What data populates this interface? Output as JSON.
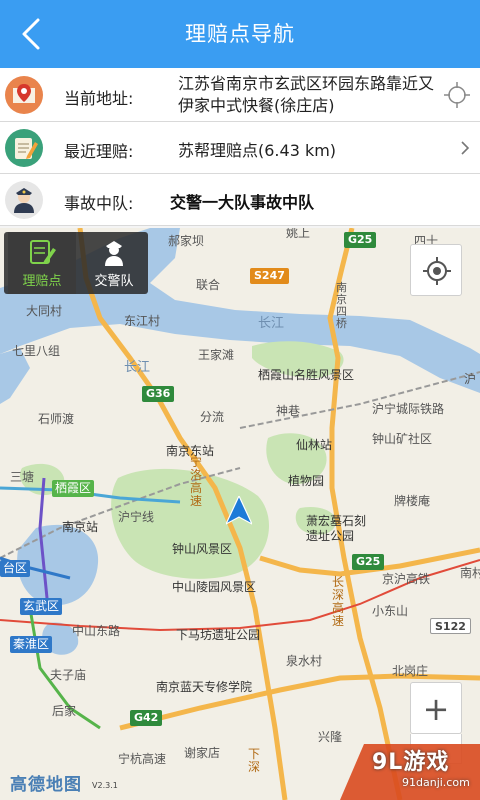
{
  "header": {
    "title": "理赔点导航"
  },
  "info": {
    "current_address": {
      "label": "当前地址:",
      "value": "江苏省南京市玄武区环园东路靠近又伊家中式快餐(徐庄店)"
    },
    "nearest_claim": {
      "label": "最近理赔:",
      "value": "苏帮理赔点(6.43 km)"
    },
    "accident_team": {
      "label": "事故中队:",
      "value": "交警一大队事故中队"
    }
  },
  "map": {
    "tabs": [
      {
        "label": "理赔点",
        "active": true
      },
      {
        "label": "交警队",
        "active": false
      }
    ],
    "logo": "高德地图",
    "version": "V2.3.1",
    "zoom_in_symbol": "+",
    "labels": {
      "jiabagang": "郝家坝",
      "yaoshang": "姚上",
      "sishi": "四十",
      "lianhe": "联合",
      "datongcun": "大同村",
      "qijiabazu": "七里八组",
      "dongjiangcun": "东江村",
      "changjiang": "长江",
      "changjiang2": "长江",
      "wangjiatan": "王家滩",
      "nanjing4qiao": "南京四桥",
      "xixia": "栖霞山名胜风景区",
      "shijiaodu": "石师渡",
      "fenliu": "分流",
      "shenxiang": "神巷",
      "huning": "沪宁城际铁路",
      "hu": "沪",
      "njdongzhan": "南京东站",
      "xianlin": "仙林站",
      "zhongshankuang": "钟山矿社区",
      "sanzhuang": "三塘",
      "qixiaqu": "栖霞区",
      "zhiwuyuan": "植物园",
      "paiyaoan": "牌楼庵",
      "njzhan": "南京站",
      "huning_line": "沪宁线",
      "ninglu": "宁洛高速",
      "zhongshan": "钟山风景区",
      "xiaohongshan": "萧宏墓石刻遗址公园",
      "nanmu": "南村",
      "jinghu": "京沪高铁",
      "zhongshanling": "中山陵园风景区",
      "xiaodongshan": "小东山",
      "xuanwu": "玄武区",
      "zhongshandong": "中山东路",
      "xiamafang": "下马坊遗址公园",
      "changshen": "长深高速",
      "qinhuai": "秦淮区",
      "fuzimiao": "夫子庙",
      "quanshuicun": "泉水村",
      "beigang": "北岗庄",
      "lantian": "南京蓝天专修学院",
      "houjia": "后家",
      "taiqu": "台区",
      "xing": "兴隆",
      "xiejiadian": "谢家店",
      "ningshang": "宁杭高速",
      "xiasheng": "下深",
      "huning_hw": "京沪高铁"
    },
    "badges": {
      "g25a": "G25",
      "s247": "S247",
      "g36": "G36",
      "g25b": "G25",
      "g42": "G42",
      "s122": "S122"
    }
  },
  "watermark": {
    "brand": "9L游戏",
    "url": "91danji.com"
  },
  "colors": {
    "header_bg": "#3a9df2",
    "tab_active": "#7fd34b",
    "water": "#a8c8e6",
    "park": "#c9e4b4",
    "highway": "#f4b64b"
  }
}
